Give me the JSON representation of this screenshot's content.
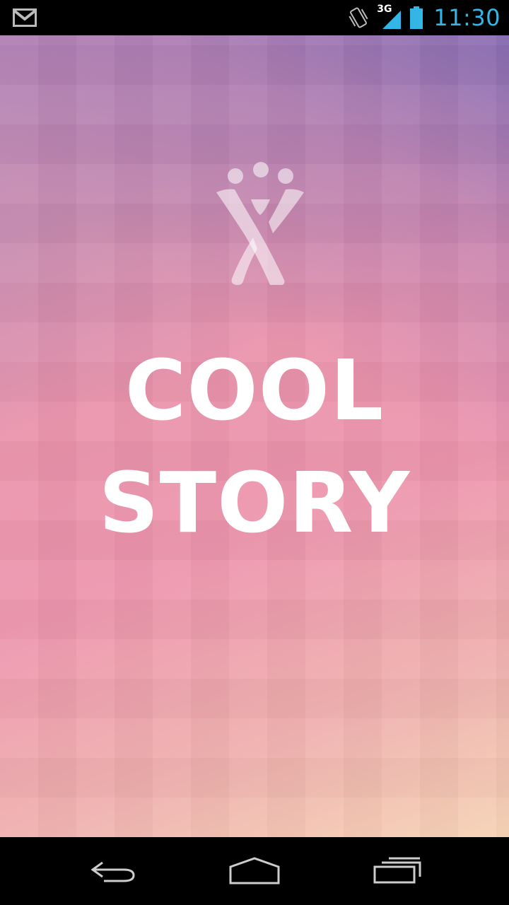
{
  "status_bar": {
    "time": "11:30",
    "network": "3G",
    "icons": [
      "gmail-icon",
      "vibrate-icon",
      "signal-icon",
      "battery-icon"
    ],
    "clock_color": "#33b5e5"
  },
  "splash": {
    "title_line1": "COOL",
    "title_line2": "STORY",
    "logo_icon": "confluence-people-logo-icon",
    "gradient_colors": [
      "#7e68b4",
      "#c68bb0",
      "#ed95ad",
      "#f6d2b4"
    ]
  },
  "nav_bar": {
    "buttons": [
      "back-icon",
      "home-icon",
      "recent-apps-icon"
    ]
  }
}
